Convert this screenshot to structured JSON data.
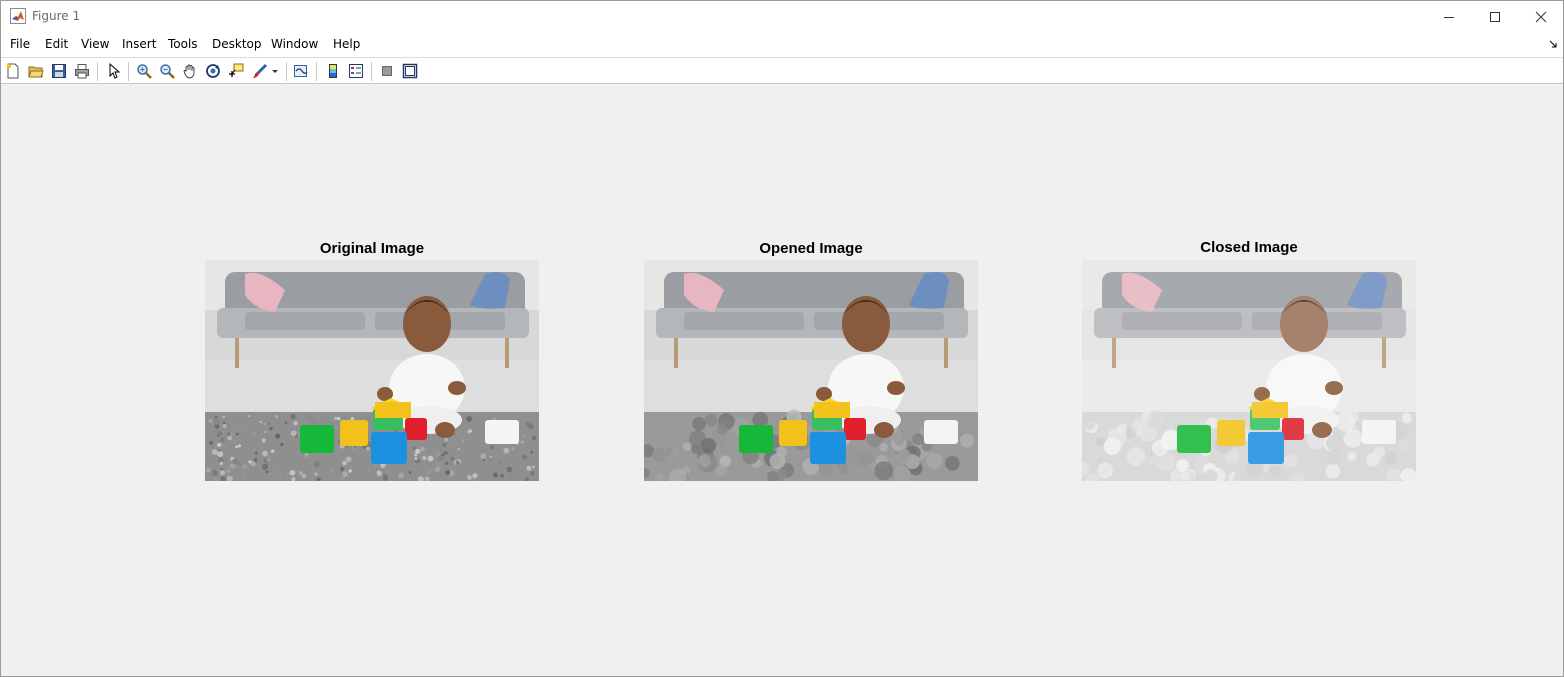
{
  "window": {
    "title": "Figure 1"
  },
  "menu": [
    "File",
    "Edit",
    "View",
    "Insert",
    "Tools",
    "Desktop",
    "Window",
    "Help"
  ],
  "toolbar": [
    "new-figure-icon",
    "open-file-icon",
    "save-icon",
    "print-icon",
    "edit-plot-pointer-icon",
    "zoom-in-icon",
    "zoom-out-icon",
    "pan-hand-icon",
    "rotate-3d-icon",
    "data-cursor-icon",
    "brush-icon",
    "brush-dropdown-icon",
    "link-plot-icon",
    "insert-colorbar-icon",
    "insert-legend-icon",
    "hide-plot-tools-icon",
    "show-plot-tools-icon"
  ],
  "panels": [
    {
      "title": "Original Image",
      "variant": "original"
    },
    {
      "title": "Opened Image",
      "variant": "opened"
    },
    {
      "title": "Closed Image",
      "variant": "closed"
    }
  ],
  "colors": {
    "matlab_logo": "#e2581c",
    "figure_bg": "#f0f0f0",
    "block_green": "#16b83a",
    "block_yellow": "#f2c21a",
    "block_red": "#e0202c",
    "block_blue": "#1e90e0",
    "sofa_gray": "#9a9ea2",
    "pillow_pink": "#e7b6c0",
    "pillow_blue": "#6d8fc0",
    "skin": "#8a5a3c"
  }
}
